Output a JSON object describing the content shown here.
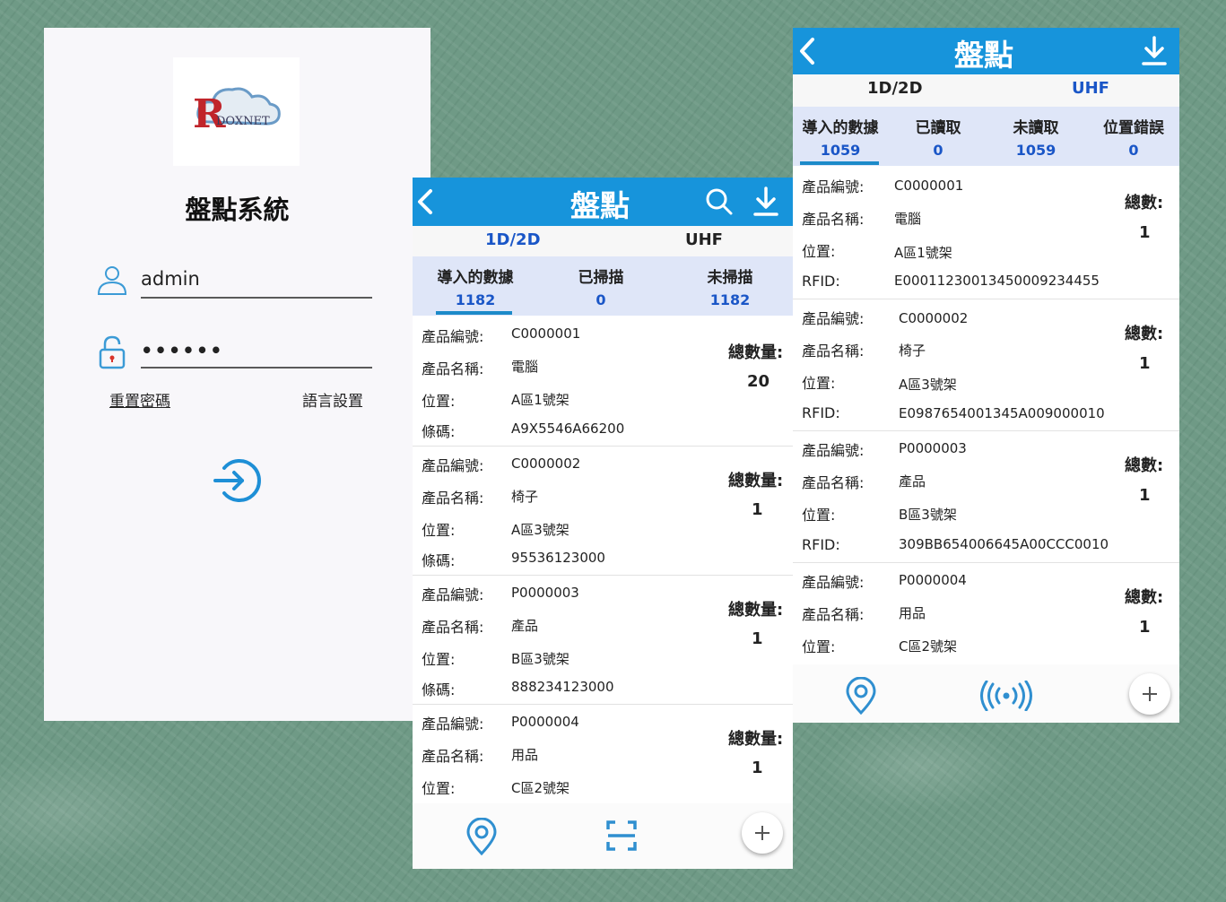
{
  "login": {
    "logo_text": "RDOXNET",
    "title": "盤點系統",
    "username": "admin",
    "password_mask": "••••••",
    "reset_password": "重置密碼",
    "language_settings": "語言設置"
  },
  "barcode_screen": {
    "title": "盤點",
    "tabs": [
      "1D/2D",
      "UHF"
    ],
    "stats": [
      {
        "label": "導入的數據",
        "value": "1182"
      },
      {
        "label": "已掃描",
        "value": "0"
      },
      {
        "label": "未掃描",
        "value": "1182"
      }
    ],
    "items": [
      {
        "code_label": "產品編號:",
        "code": "C0000001",
        "name_label": "產品名稱:",
        "name": "電腦",
        "loc_label": "位置:",
        "loc": "A區1號架",
        "bar_label": "條碼:",
        "bar": "A9X5546A66200",
        "total_label": "總數量:",
        "total": "20"
      },
      {
        "code_label": "產品編號:",
        "code": "C0000002",
        "name_label": "產品名稱:",
        "name": "椅子",
        "loc_label": "位置:",
        "loc": "A區3號架",
        "bar_label": "條碼:",
        "bar": "95536123000",
        "total_label": "總數量:",
        "total": "1"
      },
      {
        "code_label": "產品編號:",
        "code": "P0000003",
        "name_label": "產品名稱:",
        "name": "產品",
        "loc_label": "位置:",
        "loc": "B區3號架",
        "bar_label": "條碼:",
        "bar": "888234123000",
        "total_label": "總數量:",
        "total": "1"
      },
      {
        "code_label": "產品編號:",
        "code": "P0000004",
        "name_label": "產品名稱:",
        "name": "用品",
        "loc_label": "位置:",
        "loc": "C區2號架",
        "bar_label": "",
        "bar": "",
        "total_label": "總數量:",
        "total": "1"
      }
    ]
  },
  "rfid_screen": {
    "title": "盤點",
    "tabs": [
      "1D/2D",
      "UHF"
    ],
    "stats": [
      {
        "label": "導入的數據",
        "value": "1059"
      },
      {
        "label": "已讀取",
        "value": "0"
      },
      {
        "label": "未讀取",
        "value": "1059"
      },
      {
        "label": "位置錯誤",
        "value": "0"
      }
    ],
    "items": [
      {
        "code_label": "產品編號:",
        "code": "C0000001",
        "name_label": "產品名稱:",
        "name": "電腦",
        "loc_label": "位置:",
        "loc": "A區1號架",
        "rfid_label": "RFID:",
        "rfid": "E00011230013450009234455",
        "total_label": "總數:",
        "total": "1"
      },
      {
        "code_label": "產品編號:",
        "code": "C0000002",
        "name_label": "產品名稱:",
        "name": "椅子",
        "loc_label": "位置:",
        "loc": "A區3號架",
        "rfid_label": "RFID:",
        "rfid": "E0987654001345A009000010",
        "total_label": "總數:",
        "total": "1"
      },
      {
        "code_label": "產品編號:",
        "code": "P0000003",
        "name_label": "產品名稱:",
        "name": "產品",
        "loc_label": "位置:",
        "loc": "B區3號架",
        "rfid_label": "RFID:",
        "rfid": "309BB654006645A00CCC0010",
        "total_label": "總數:",
        "total": "1"
      },
      {
        "code_label": "產品編號:",
        "code": "P0000004",
        "name_label": "產品名稱:",
        "name": "用品",
        "loc_label": "位置:",
        "loc": "C區2號架",
        "rfid_label": "",
        "rfid": "",
        "total_label": "總數:",
        "total": "1"
      }
    ]
  },
  "colors": {
    "primary": "#1794db",
    "stats_bg": "#dfe6f8",
    "value_blue": "#1a56c7"
  },
  "icons": [
    "user-icon",
    "lock-icon",
    "login-arrow-icon",
    "back-icon",
    "search-icon",
    "download-icon",
    "location-pin-icon",
    "scan-icon",
    "rfid-signal-icon",
    "plus-icon"
  ]
}
